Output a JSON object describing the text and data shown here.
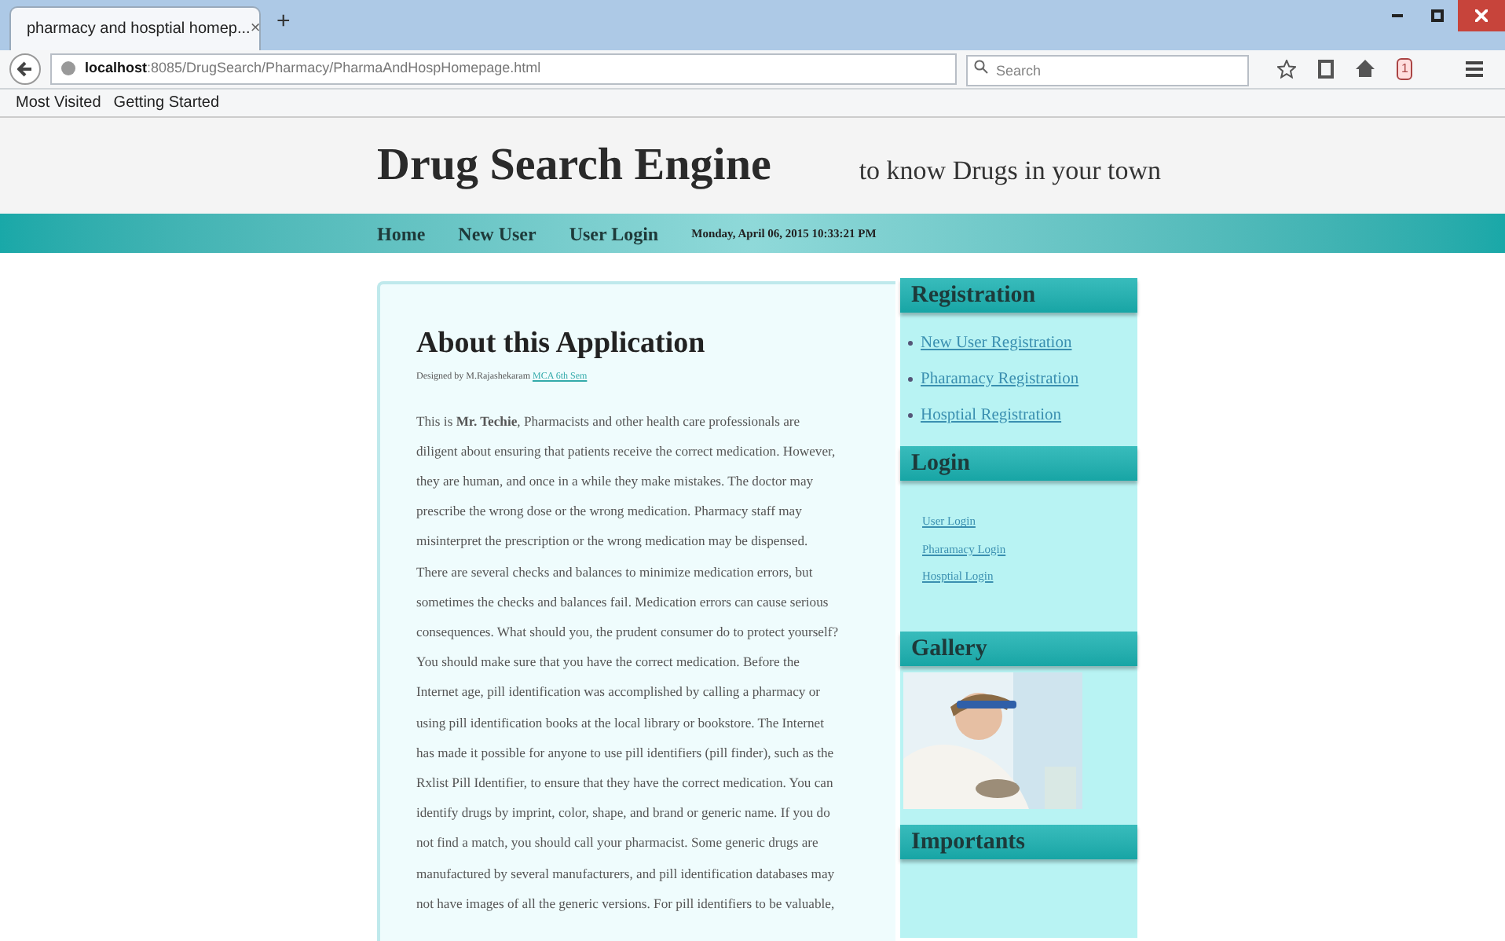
{
  "browser": {
    "tab": {
      "title": "pharmacy and hosptial homep...",
      "close": "×"
    },
    "new_tab": "+",
    "url": {
      "host": "localhost",
      "path": ":8085/DrugSearch/Pharmacy/PharmaAndHospHomepage.html"
    },
    "search": {
      "placeholder": "Search"
    },
    "badge": "1",
    "bookmarks": [
      "Most Visited",
      "Getting Started"
    ]
  },
  "header": {
    "title": "Drug Search Engine",
    "tagline": "to know Drugs in your town"
  },
  "nav": {
    "items": [
      "Home",
      "New User",
      "User Login"
    ],
    "datetime": "Monday, April 06, 2015 10:33:21 PM"
  },
  "article": {
    "heading": "About this Application",
    "byline": "Designed by M.Rajashekaram",
    "byline_link": "MCA 6th Sem",
    "body_lines": [
      "This is **Mr. Techie**, Pharmacists and other health care professionals are",
      "diligent about ensuring that patients receive the correct medication. However,",
      "they are human, and once in a while they make mistakes. The doctor may",
      "prescribe the wrong dose or the wrong medication. Pharmacy staff may",
      "misinterpret the prescription or the wrong medication may be dispensed.",
      "There are several checks and balances to minimize medication errors, but",
      "sometimes the checks and balances fail. Medication errors can cause serious",
      "consequences. What should you, the prudent consumer do to protect yourself?",
      "You should make sure that you have the correct medication. Before the",
      "Internet age, pill identification was accomplished by calling a pharmacy or",
      "using pill identification books at the local library or bookstore. The Internet",
      "has made it possible for anyone to use pill identifiers (pill finder), such as the",
      "Rxlist Pill Identifier, to ensure that they have the correct medication. You can",
      "identify drugs by imprint, color, shape, and brand or generic name. If you do",
      "not find a match, you should call your pharmacist. Some generic drugs are",
      "manufactured by several manufacturers, and pill identification databases may",
      "not have images of all the generic versions. For pill identifiers to be valuable,"
    ]
  },
  "sidebar": [
    {
      "kind": "bullets",
      "title": "Registration",
      "links": [
        "New User Registration",
        "Pharamacy Registration",
        "Hosptial Registration"
      ]
    },
    {
      "kind": "small",
      "title": "Login",
      "links": [
        "User Login",
        "Pharamacy Login",
        "Hosptial Login"
      ]
    },
    {
      "kind": "gallery",
      "title": "Gallery"
    },
    {
      "kind": "empty",
      "title": "Importants"
    }
  ]
}
